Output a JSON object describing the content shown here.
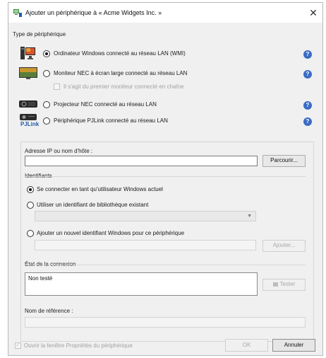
{
  "window": {
    "title": "Ajouter un périphérique à « Acme Widgets Inc. »",
    "close_glyph": "✕"
  },
  "device_type": {
    "label": "Type de périphérique",
    "options": [
      {
        "label": "Ordinateur Windows connecté au réseau LAN (WMI)",
        "selected": true,
        "icon": "windows-computer-icon"
      },
      {
        "label": "Moniteur NEC à écran large connecté au réseau LAN",
        "selected": false,
        "icon": "nec-monitor-icon"
      },
      {
        "label": "Projecteur NEC connecté au réseau LAN",
        "selected": false,
        "icon": "nec-projector-icon"
      },
      {
        "label": "Périphérique PJLink connecté au réseau LAN",
        "selected": false,
        "icon": "pjlink-icon"
      }
    ],
    "chained_monitor_label": "Il s'agit du premier moniteur connecté en chaîne",
    "pjlink_logo_text": "PJLink",
    "help_glyph": "?"
  },
  "address": {
    "label": "Adresse IP ou nom d'hôte :",
    "value": "",
    "browse_label": "Parcourir..."
  },
  "credentials": {
    "label": "Identifiants",
    "options": [
      {
        "label": "Se connecter en tant qu'utilisateur Windows actuel",
        "selected": true
      },
      {
        "label": "Utiliser un identifiant de bibliothèque existant",
        "selected": false
      },
      {
        "label": "Ajouter un nouvel identifiant Windows pour ce périphérique",
        "selected": false
      }
    ],
    "select_value": "",
    "add_label": "Ajouter..."
  },
  "connection": {
    "label": "État de la connexion",
    "status": "Non testé",
    "test_label": "Tester"
  },
  "reference": {
    "label": "Nom de référence :",
    "value": ""
  },
  "footer": {
    "open_properties_label": "Ouvrir la fenêtre Propriétés du périphérique",
    "ok_label": "OK",
    "cancel_label": "Annuler"
  },
  "colors": {
    "help": "#3b6cc4",
    "dialog_bg": "#f0f0f0"
  }
}
